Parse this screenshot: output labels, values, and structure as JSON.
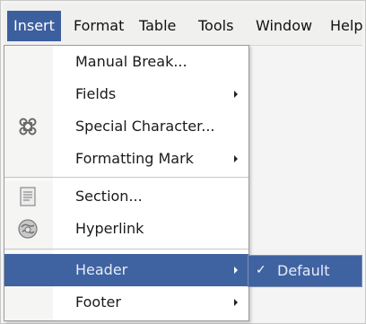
{
  "menubar": {
    "items": [
      {
        "label": "Insert"
      },
      {
        "label": "Format"
      },
      {
        "label": "Table"
      },
      {
        "label": "Tools"
      },
      {
        "label": "Window"
      },
      {
        "label": "Help"
      }
    ]
  },
  "insert_menu": {
    "items": [
      {
        "label": "Manual Break...",
        "has_submenu": false
      },
      {
        "label": "Fields",
        "has_submenu": true
      },
      {
        "label": "Special Character...",
        "has_submenu": false,
        "icon": "special-character-icon"
      },
      {
        "label": "Formatting Mark",
        "has_submenu": true
      },
      {
        "label": "Section...",
        "has_submenu": false,
        "icon": "section-icon"
      },
      {
        "label": "Hyperlink",
        "has_submenu": false,
        "icon": "hyperlink-icon"
      },
      {
        "label": "Header",
        "has_submenu": true,
        "highlighted": true
      },
      {
        "label": "Footer",
        "has_submenu": true
      }
    ]
  },
  "header_submenu": {
    "items": [
      {
        "label": "Default",
        "checked": true
      }
    ]
  },
  "colors": {
    "highlight": "#3f62a1",
    "menu_background": "#ffffff",
    "icon_strip": "#f5f5f3"
  }
}
